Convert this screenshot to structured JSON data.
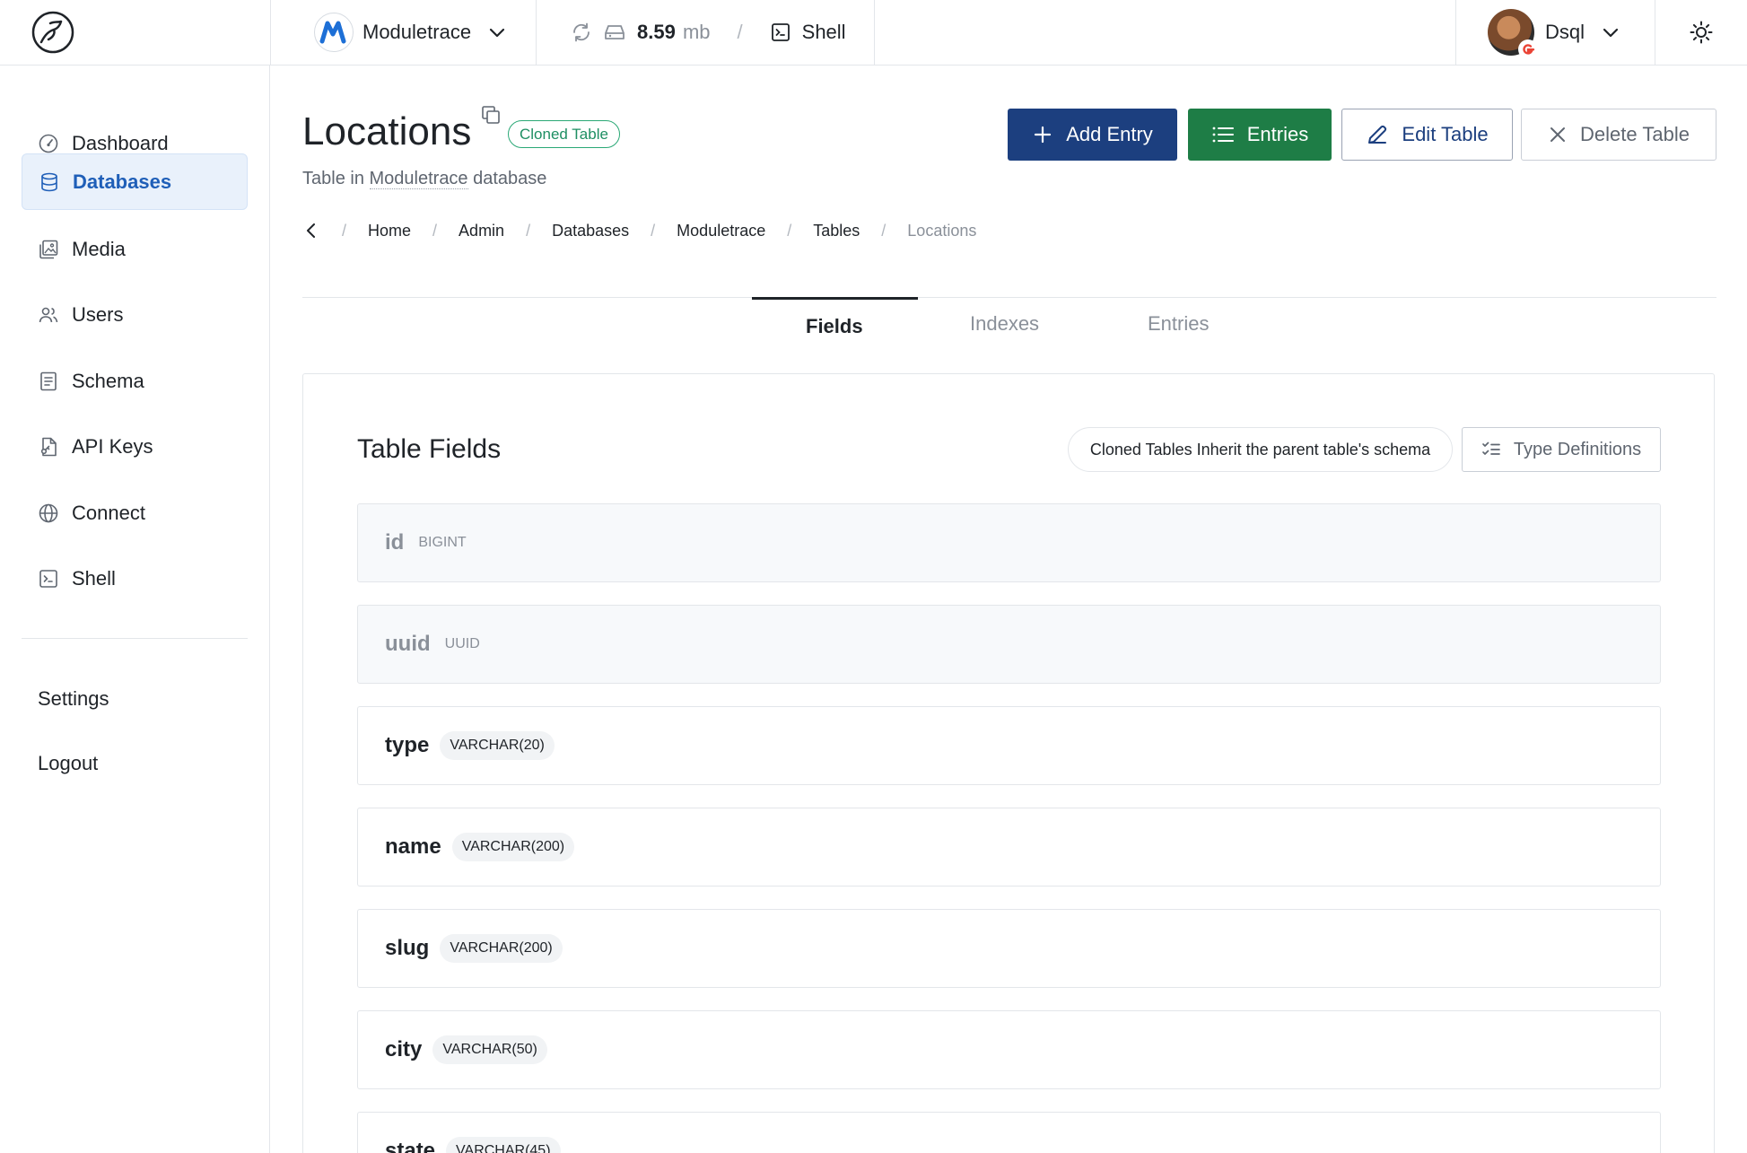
{
  "topbar": {
    "database_name": "Moduletrace",
    "storage_size": "8.59",
    "storage_unit": "mb",
    "shell_label": "Shell",
    "user_name": "Dsql"
  },
  "sidebar": {
    "items": [
      {
        "label": "Dashboard",
        "icon": "gauge-icon"
      },
      {
        "label": "Databases",
        "icon": "database-icon",
        "active": true
      },
      {
        "label": "Media",
        "icon": "images-icon"
      },
      {
        "label": "Users",
        "icon": "users-icon"
      },
      {
        "label": "Schema",
        "icon": "document-icon"
      },
      {
        "label": "API Keys",
        "icon": "key-file-icon"
      },
      {
        "label": "Connect",
        "icon": "globe-icon"
      },
      {
        "label": "Shell",
        "icon": "terminal-icon"
      }
    ],
    "settings_label": "Settings",
    "logout_label": "Logout"
  },
  "header": {
    "title": "Locations",
    "badge": "Cloned Table",
    "subtitle_prefix": "Table in",
    "subtitle_db": "Moduletrace",
    "subtitle_suffix": "database",
    "actions": {
      "add_entry": "Add Entry",
      "entries": "Entries",
      "edit_table": "Edit Table",
      "delete_table": "Delete Table"
    },
    "breadcrumb": [
      "Home",
      "Admin",
      "Databases",
      "Moduletrace",
      "Tables",
      "Locations"
    ]
  },
  "tabs": [
    {
      "label": "Fields",
      "active": true
    },
    {
      "label": "Indexes",
      "active": false
    },
    {
      "label": "Entries",
      "active": false
    }
  ],
  "panel": {
    "title": "Table Fields",
    "notice": "Cloned Tables Inherit the parent table's schema",
    "type_definitions_label": "Type Definitions",
    "fields": [
      {
        "name": "id",
        "type": "BIGINT",
        "system": true
      },
      {
        "name": "uuid",
        "type": "UUID",
        "system": true
      },
      {
        "name": "type",
        "type": "VARCHAR(20)",
        "system": false
      },
      {
        "name": "name",
        "type": "VARCHAR(200)",
        "system": false
      },
      {
        "name": "slug",
        "type": "VARCHAR(200)",
        "system": false
      },
      {
        "name": "city",
        "type": "VARCHAR(50)",
        "system": false
      },
      {
        "name": "state",
        "type": "VARCHAR(45)",
        "system": false
      }
    ]
  },
  "colors": {
    "primary": "#1c3f7f",
    "success": "#1e7d46",
    "active_nav_bg": "#e9f1fb",
    "active_nav_text": "#1f5fb8",
    "badge_green": "#1e8f63"
  }
}
